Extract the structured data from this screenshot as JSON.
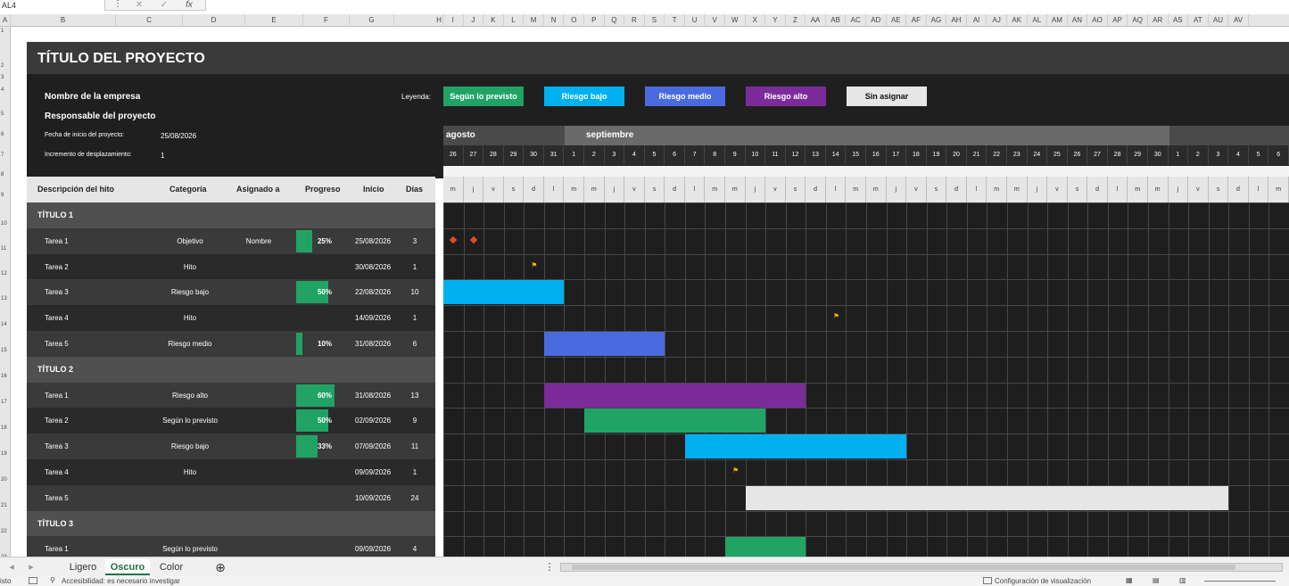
{
  "formula_bar": {
    "name_box": "AL4",
    "cancel_icon": "✕",
    "confirm_icon": "✓",
    "fx_label": "fx"
  },
  "columns": [
    "A",
    "B",
    "C",
    "D",
    "E",
    "F",
    "G",
    "H",
    "I",
    "J",
    "K",
    "L",
    "M",
    "N",
    "O",
    "P",
    "Q",
    "R",
    "S",
    "T",
    "U",
    "V",
    "W",
    "X",
    "Y",
    "Z",
    "AA",
    "AB",
    "AC",
    "AD",
    "AE",
    "AF",
    "AG",
    "AH",
    "AI",
    "AJ",
    "AK",
    "AL",
    "AM",
    "AN",
    "AO",
    "AP",
    "AQ",
    "AR",
    "AS",
    "AT",
    "AU",
    "AV"
  ],
  "rows": [
    "1",
    "2",
    "3",
    "4",
    "5",
    "6",
    "7",
    "8",
    "9",
    "10",
    "11",
    "12",
    "13",
    "14",
    "15",
    "16",
    "17",
    "18",
    "19",
    "20",
    "21",
    "22",
    "23"
  ],
  "project": {
    "title": "TÍTULO DEL PROYECTO",
    "company": "Nombre de la empresa",
    "manager": "Responsable del proyecto",
    "start_label": "Fecha de inicio del proyecto:",
    "start_value": "25/08/2026",
    "scroll_label": "Incremento de desplazamiento:",
    "scroll_value": "1"
  },
  "legend": {
    "label": "Leyenda:",
    "items": [
      {
        "label": "Según lo previsto",
        "color": "#21a366"
      },
      {
        "label": "Riesgo bajo",
        "color": "#00b0f0"
      },
      {
        "label": "Riesgo medio",
        "color": "#4a6bdf"
      },
      {
        "label": "Riesgo alto",
        "color": "#7b2c9a"
      },
      {
        "label": "Sin asignar",
        "color": "#e6e6e6"
      }
    ]
  },
  "months": [
    "agosto",
    "septiembre"
  ],
  "days": [
    "26",
    "27",
    "28",
    "29",
    "30",
    "31",
    "1",
    "2",
    "3",
    "4",
    "5",
    "6",
    "7",
    "8",
    "9",
    "10",
    "11",
    "12",
    "13",
    "14",
    "15",
    "16",
    "17",
    "18",
    "19",
    "20",
    "21",
    "22",
    "23",
    "24",
    "25",
    "26",
    "27",
    "28",
    "29",
    "30",
    "1",
    "2",
    "3",
    "4",
    "5",
    "6"
  ],
  "day_letters": [
    "m",
    "j",
    "v",
    "s",
    "d",
    "l",
    "m",
    "m",
    "j",
    "v",
    "s",
    "d",
    "l",
    "m",
    "m",
    "j",
    "v",
    "s",
    "d",
    "l",
    "m",
    "m",
    "j",
    "v",
    "s",
    "d",
    "l",
    "m",
    "m",
    "j",
    "v",
    "s",
    "d",
    "l",
    "m",
    "m",
    "j",
    "v",
    "s",
    "d",
    "l",
    "m"
  ],
  "table_header": {
    "description": "Descripción del hito",
    "category": "Categoría",
    "assigned": "Asignado a",
    "progress": "Progreso",
    "start": "Inicio",
    "days": "Días"
  },
  "rows_data": [
    {
      "type": "section",
      "name": "TÍTULO 1"
    },
    {
      "type": "task",
      "name": "Tarea 1",
      "category": "Objetivo",
      "assigned": "Nombre",
      "progress": "25%",
      "progress_fraction": 0.25,
      "start": "25/08/2026",
      "days": "3"
    },
    {
      "type": "task",
      "name": "Tarea 2",
      "category": "Hito",
      "assigned": "",
      "progress": "",
      "progress_fraction": 0,
      "start": "30/08/2026",
      "days": "1"
    },
    {
      "type": "task",
      "name": "Tarea 3",
      "category": "Riesgo bajo",
      "assigned": "",
      "progress": "50%",
      "progress_fraction": 0.5,
      "start": "22/08/2026",
      "days": "10"
    },
    {
      "type": "task",
      "name": "Tarea 4",
      "category": "Hito",
      "assigned": "",
      "progress": "",
      "progress_fraction": 0,
      "start": "14/09/2026",
      "days": "1"
    },
    {
      "type": "task",
      "name": "Tarea 5",
      "category": "Riesgo medio",
      "assigned": "",
      "progress": "10%",
      "progress_fraction": 0.1,
      "start": "31/08/2026",
      "days": "6"
    },
    {
      "type": "section",
      "name": "TÍTULO 2"
    },
    {
      "type": "task",
      "name": "Tarea 1",
      "category": "Riesgo alto",
      "assigned": "",
      "progress": "60%",
      "progress_fraction": 0.6,
      "start": "31/08/2026",
      "days": "13"
    },
    {
      "type": "task",
      "name": "Tarea 2",
      "category": "Según lo previsto",
      "assigned": "",
      "progress": "50%",
      "progress_fraction": 0.5,
      "start": "02/09/2026",
      "days": "9"
    },
    {
      "type": "task",
      "name": "Tarea 3",
      "category": "Riesgo bajo",
      "assigned": "",
      "progress": "33%",
      "progress_fraction": 0.33,
      "start": "07/09/2026",
      "days": "11"
    },
    {
      "type": "task",
      "name": "Tarea 4",
      "category": "Hito",
      "assigned": "",
      "progress": "",
      "progress_fraction": 0,
      "start": "09/09/2026",
      "days": "1"
    },
    {
      "type": "task",
      "name": "Tarea 5",
      "category": "",
      "assigned": "",
      "progress": "",
      "progress_fraction": 0,
      "start": "10/09/2026",
      "days": "24"
    },
    {
      "type": "section",
      "name": "TÍTULO 3"
    },
    {
      "type": "task",
      "name": "Tarea 1",
      "category": "Según lo previsto",
      "assigned": "",
      "progress": "",
      "progress_fraction": 0,
      "start": "09/09/2026",
      "days": "4"
    }
  ],
  "gantt_items": [
    {
      "row": 1,
      "kind": "diamond",
      "day": 0,
      "color": "#e04a2a"
    },
    {
      "row": 1,
      "kind": "diamond",
      "day": 1,
      "color": "#e04a2a"
    },
    {
      "row": 2,
      "kind": "flag",
      "day": 4,
      "color": "#f0b400"
    },
    {
      "row": 3,
      "kind": "bar",
      "day": 0,
      "span": 6,
      "color": "#00b0f0"
    },
    {
      "row": 4,
      "kind": "flag",
      "day": 19,
      "color": "#f0b400"
    },
    {
      "row": 5,
      "kind": "bar",
      "day": 5,
      "span": 6,
      "color": "#4a6bdf"
    },
    {
      "row": 7,
      "kind": "bar",
      "day": 5,
      "span": 13,
      "color": "#7b2c9a"
    },
    {
      "row": 8,
      "kind": "bar",
      "day": 7,
      "span": 9,
      "color": "#21a366"
    },
    {
      "row": 9,
      "kind": "bar",
      "day": 12,
      "span": 11,
      "color": "#00b0f0"
    },
    {
      "row": 10,
      "kind": "flag",
      "day": 14,
      "color": "#f0b400"
    },
    {
      "row": 11,
      "kind": "bar",
      "day": 15,
      "span": 24,
      "color": "#e6e6e6"
    },
    {
      "row": 13,
      "kind": "bar",
      "day": 14,
      "span": 4,
      "color": "#21a366"
    }
  ],
  "sheet_tabs": [
    "Ligero",
    "Oscuro",
    "Color"
  ],
  "active_tab": "Oscuro",
  "status": {
    "left": "isto",
    "accessibility": "Accesibilidad: es necesario investigar",
    "display_settings": "Configuración de visualización"
  }
}
